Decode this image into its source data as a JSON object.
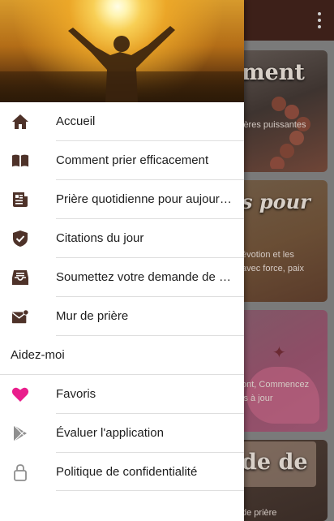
{
  "app_bar": {
    "overflow_icon": "more-vert-icon"
  },
  "background_cards": [
    {
      "title": "ment",
      "text": [
        "ières puissantes"
      ]
    },
    {
      "title": "s pour",
      "text": [
        "évotion et les",
        "avec force, paix"
      ]
    },
    {
      "title": "",
      "text": [
        "ont, Commencez",
        "is à jour"
      ]
    },
    {
      "title": "de de",
      "text": [
        "de prière"
      ]
    }
  ],
  "drawer": {
    "menu": [
      {
        "icon": "home-icon",
        "label": "Accueil"
      },
      {
        "icon": "book-open-icon",
        "label": "Comment prier efficacement"
      },
      {
        "icon": "newspaper-icon",
        "label": "Prière quotidienne pour aujourd'hui"
      },
      {
        "icon": "shield-check-icon",
        "label": "Citations du jour"
      },
      {
        "icon": "inbox-tray-icon",
        "label": "Soumettez votre demande de prière"
      },
      {
        "icon": "mail-badge-icon",
        "label": "Mur de prière"
      }
    ],
    "section_header": "Aidez-moi",
    "help_menu": [
      {
        "icon": "heart-icon",
        "label": "Favoris"
      },
      {
        "icon": "play-store-icon",
        "label": "Évaluer l'application"
      },
      {
        "icon": "lock-icon",
        "label": "Politique de confidentialité"
      }
    ]
  },
  "colors": {
    "app_bar": "#3d2019",
    "icon_brown": "#4e3229",
    "favorite_pink": "#e91e8c",
    "muted_icon": "#8f8f8f"
  }
}
